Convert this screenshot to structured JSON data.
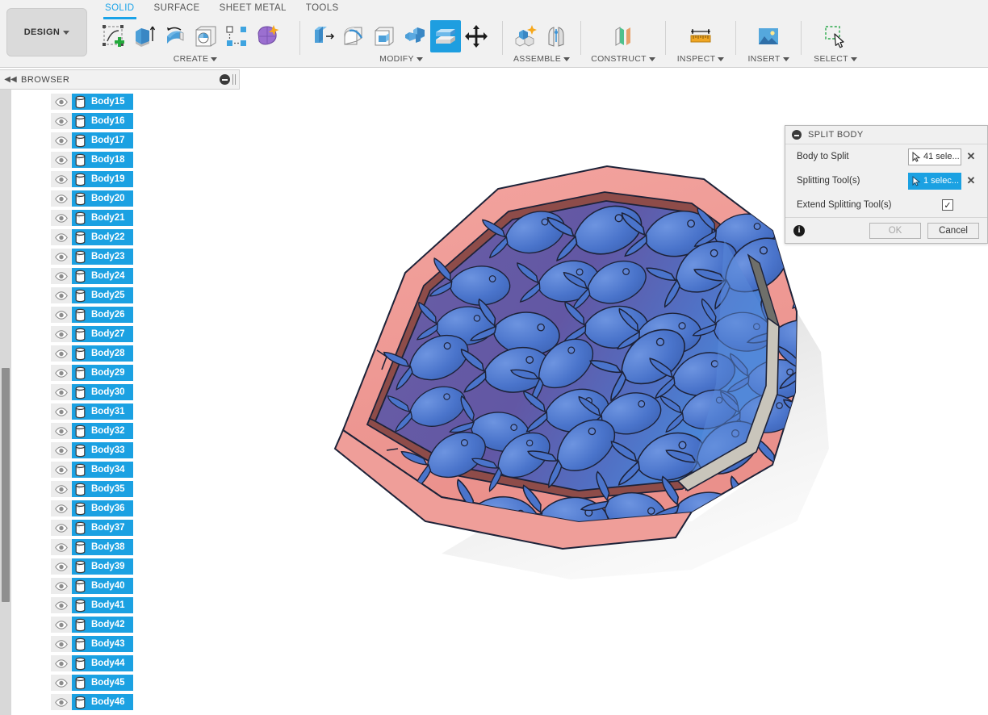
{
  "app": {
    "workspace_button": "DESIGN",
    "tabs": [
      {
        "label": "SOLID",
        "active": true
      },
      {
        "label": "SURFACE",
        "active": false
      },
      {
        "label": "SHEET METAL",
        "active": false
      },
      {
        "label": "TOOLS",
        "active": false
      }
    ]
  },
  "ribbon": {
    "groups": [
      {
        "label": "CREATE",
        "icons": [
          "create-sketch-icon",
          "extrude-icon",
          "revolve-icon",
          "hole-icon",
          "pattern-icon",
          "form-icon"
        ]
      },
      {
        "label": "MODIFY",
        "icons": [
          "press-pull-icon",
          "fillet-icon",
          "shell-icon",
          "combine-icon",
          "split-body-icon",
          "move-copy-icon"
        ],
        "selected_icon": "split-body-icon"
      },
      {
        "label": "ASSEMBLE",
        "icons": [
          "new-component-icon",
          "joint-icon"
        ]
      },
      {
        "label": "CONSTRUCT",
        "icons": [
          "offset-plane-icon"
        ]
      },
      {
        "label": "INSPECT",
        "icons": [
          "measure-icon"
        ]
      },
      {
        "label": "INSERT",
        "icons": [
          "insert-image-icon"
        ]
      },
      {
        "label": "SELECT",
        "icons": [
          "select-window-icon"
        ]
      }
    ]
  },
  "browser": {
    "title": "BROWSER",
    "collapse_icon": "collapse-left-icon",
    "minimize_icon": "minimize-icon",
    "grip_icon": "resize-grip-icon",
    "eye_icon": "visibility-eye-icon",
    "body_icon": "body-solid-icon",
    "items": [
      {
        "label": "Body15",
        "selected": true
      },
      {
        "label": "Body16",
        "selected": true
      },
      {
        "label": "Body17",
        "selected": true
      },
      {
        "label": "Body18",
        "selected": true
      },
      {
        "label": "Body19",
        "selected": true
      },
      {
        "label": "Body20",
        "selected": true
      },
      {
        "label": "Body21",
        "selected": true
      },
      {
        "label": "Body22",
        "selected": true
      },
      {
        "label": "Body23",
        "selected": true
      },
      {
        "label": "Body24",
        "selected": true
      },
      {
        "label": "Body25",
        "selected": true
      },
      {
        "label": "Body26",
        "selected": true
      },
      {
        "label": "Body27",
        "selected": true
      },
      {
        "label": "Body28",
        "selected": true
      },
      {
        "label": "Body29",
        "selected": true
      },
      {
        "label": "Body30",
        "selected": true
      },
      {
        "label": "Body31",
        "selected": true
      },
      {
        "label": "Body32",
        "selected": true
      },
      {
        "label": "Body33",
        "selected": true
      },
      {
        "label": "Body34",
        "selected": true
      },
      {
        "label": "Body35",
        "selected": true
      },
      {
        "label": "Body36",
        "selected": true
      },
      {
        "label": "Body37",
        "selected": true
      },
      {
        "label": "Body38",
        "selected": true
      },
      {
        "label": "Body39",
        "selected": true
      },
      {
        "label": "Body40",
        "selected": true
      },
      {
        "label": "Body41",
        "selected": true
      },
      {
        "label": "Body42",
        "selected": true
      },
      {
        "label": "Body43",
        "selected": true
      },
      {
        "label": "Body44",
        "selected": true
      },
      {
        "label": "Body45",
        "selected": true
      },
      {
        "label": "Body46",
        "selected": true
      }
    ]
  },
  "dialog": {
    "title": "SPLIT BODY",
    "minimize_icon": "minimize-icon",
    "rows": [
      {
        "label": "Body to Split",
        "value": "41 sele...",
        "active": false,
        "clear_icon": "clear-x-icon"
      },
      {
        "label": "Splitting Tool(s)",
        "value": "1 selec...",
        "active": true,
        "clear_icon": "clear-x-icon"
      }
    ],
    "checkbox_row": {
      "label": "Extend Splitting Tool(s)",
      "checked": true,
      "check_glyph": "✓"
    },
    "info_icon": "info-icon",
    "ok_label": "OK",
    "ok_disabled": true,
    "cancel_label": "Cancel"
  },
  "canvas": {
    "model_name": "fish-pattern-split-body-model",
    "colors": {
      "rim": "#f19a96",
      "rim_shadow": "#a8514d",
      "plate": "#6b5fa8",
      "fish": "#4a72c8",
      "edge": "#1b1b2e",
      "side_gray": "#c9c5bb",
      "highlight": "#5d8fe0"
    }
  },
  "theme": {
    "accent": "#1ba1e2",
    "tab_active": "#1aa3e8",
    "toolbar_bg": "#f1f1f1",
    "panel_bg": "#f0f0f0"
  }
}
